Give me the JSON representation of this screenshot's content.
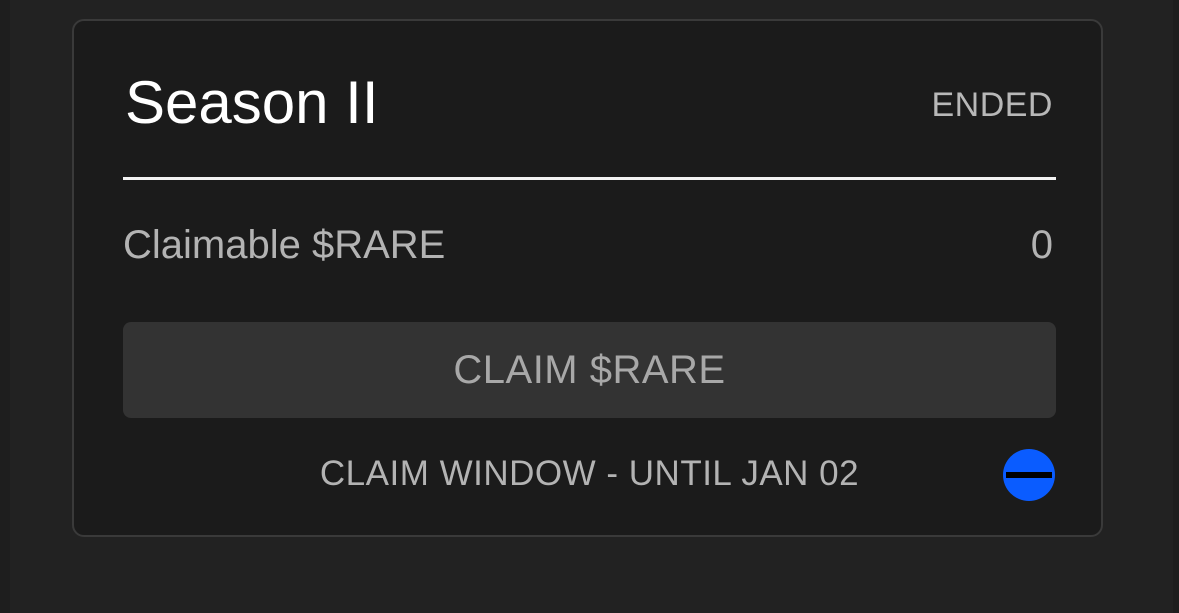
{
  "card": {
    "title": "Season II",
    "status": "ENDED",
    "claimable_label": "Claimable $RARE",
    "claimable_value": "0",
    "claim_button_label": "CLAIM $RARE",
    "claim_window_text": "CLAIM WINDOW - UNTIL JAN 02",
    "status_icon": "minus-circle-icon"
  },
  "colors": {
    "background": "#222222",
    "card_background": "#1b1b1b",
    "card_border": "#3a3a3a",
    "title": "#ffffff",
    "muted_text": "#b3b3b3",
    "button_background": "#333333",
    "accent_blue": "#0a5cff"
  }
}
